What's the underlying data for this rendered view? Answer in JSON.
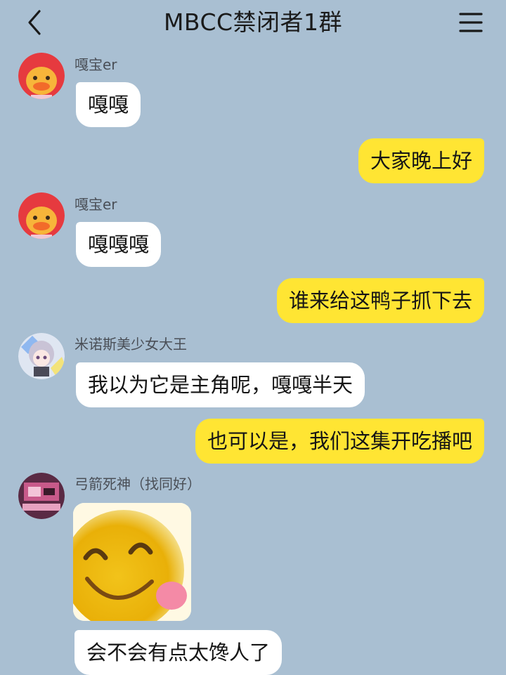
{
  "header": {
    "title": "MBCC禁闭者1群",
    "back_icon": "chevron-left-icon",
    "menu_icon": "hamburger-menu-icon"
  },
  "messages": [
    {
      "sender": "嘎宝er",
      "text": "嘎嘎",
      "direction": "incoming",
      "avatar": "duck-avatar"
    },
    {
      "text": "大家晚上好",
      "direction": "outgoing"
    },
    {
      "sender": "嘎宝er",
      "text": "嘎嘎嘎",
      "direction": "incoming",
      "avatar": "duck-avatar"
    },
    {
      "text": "谁来给这鸭子抓下去",
      "direction": "outgoing"
    },
    {
      "sender": "米诺斯美少女大王",
      "text": "我以为它是主角呢，嘎嘎半天",
      "direction": "incoming",
      "avatar": "anime-girl-avatar"
    },
    {
      "text": "也可以是，我们这集开吃播吧",
      "direction": "outgoing"
    },
    {
      "sender": "弓箭死神（找同好）",
      "direction": "incoming",
      "avatar": "room-avatar",
      "sticker": "blushing-smiley-sticker"
    },
    {
      "text": "会不会有点太馋人了",
      "direction": "incoming"
    }
  ],
  "colors": {
    "background": "#a9bfd2",
    "incoming_bubble": "#ffffff",
    "outgoing_bubble": "#ffe533"
  }
}
